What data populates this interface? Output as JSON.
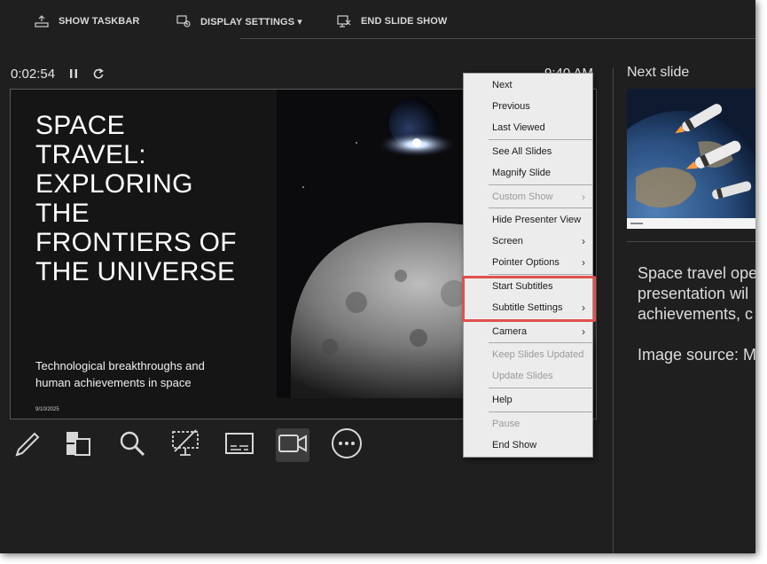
{
  "toolbar": {
    "show_taskbar": "SHOW TASKBAR",
    "display_settings": "DISPLAY SETTINGS ▾",
    "end_slide_show": "END SLIDE SHOW"
  },
  "timer": {
    "elapsed": "0:02:54",
    "clock": "9:40 AM"
  },
  "slide": {
    "title": "SPACE\nTRAVEL:\nEXPLORING\nTHE\nFRONTIERS OF\nTHE UNIVERSE",
    "subtitle": "Technological breakthroughs and\nhuman achievements in space",
    "date": "9/10/2025"
  },
  "tools": [
    "pen-icon",
    "see-all-slides-icon",
    "zoom-icon",
    "black-screen-icon",
    "subtitles-icon",
    "camera-icon",
    "more-options-icon"
  ],
  "next_slide": {
    "label": "Next slide"
  },
  "notes": {
    "line1": "Space travel ope",
    "line2": "presentation wil",
    "line3": "achievements, c",
    "line4": "Image source: M"
  },
  "menu": {
    "next": "Next",
    "previous": "Previous",
    "last_viewed": "Last Viewed",
    "see_all_slides": "See All Slides",
    "magnify_slide": "Magnify Slide",
    "custom_show": "Custom Show",
    "hide_presenter_view": "Hide Presenter View",
    "screen": "Screen",
    "pointer_options": "Pointer Options",
    "start_subtitles": "Start Subtitles",
    "subtitle_settings": "Subtitle Settings",
    "camera": "Camera",
    "keep_slides_updated": "Keep Slides Updated",
    "update_slides": "Update Slides",
    "help": "Help",
    "pause": "Pause",
    "end_show": "End Show",
    "submenu_arrow": "›"
  },
  "colors": {
    "highlight": "#e0504f",
    "background": "#1f1f1f",
    "menu": "#ececec"
  }
}
